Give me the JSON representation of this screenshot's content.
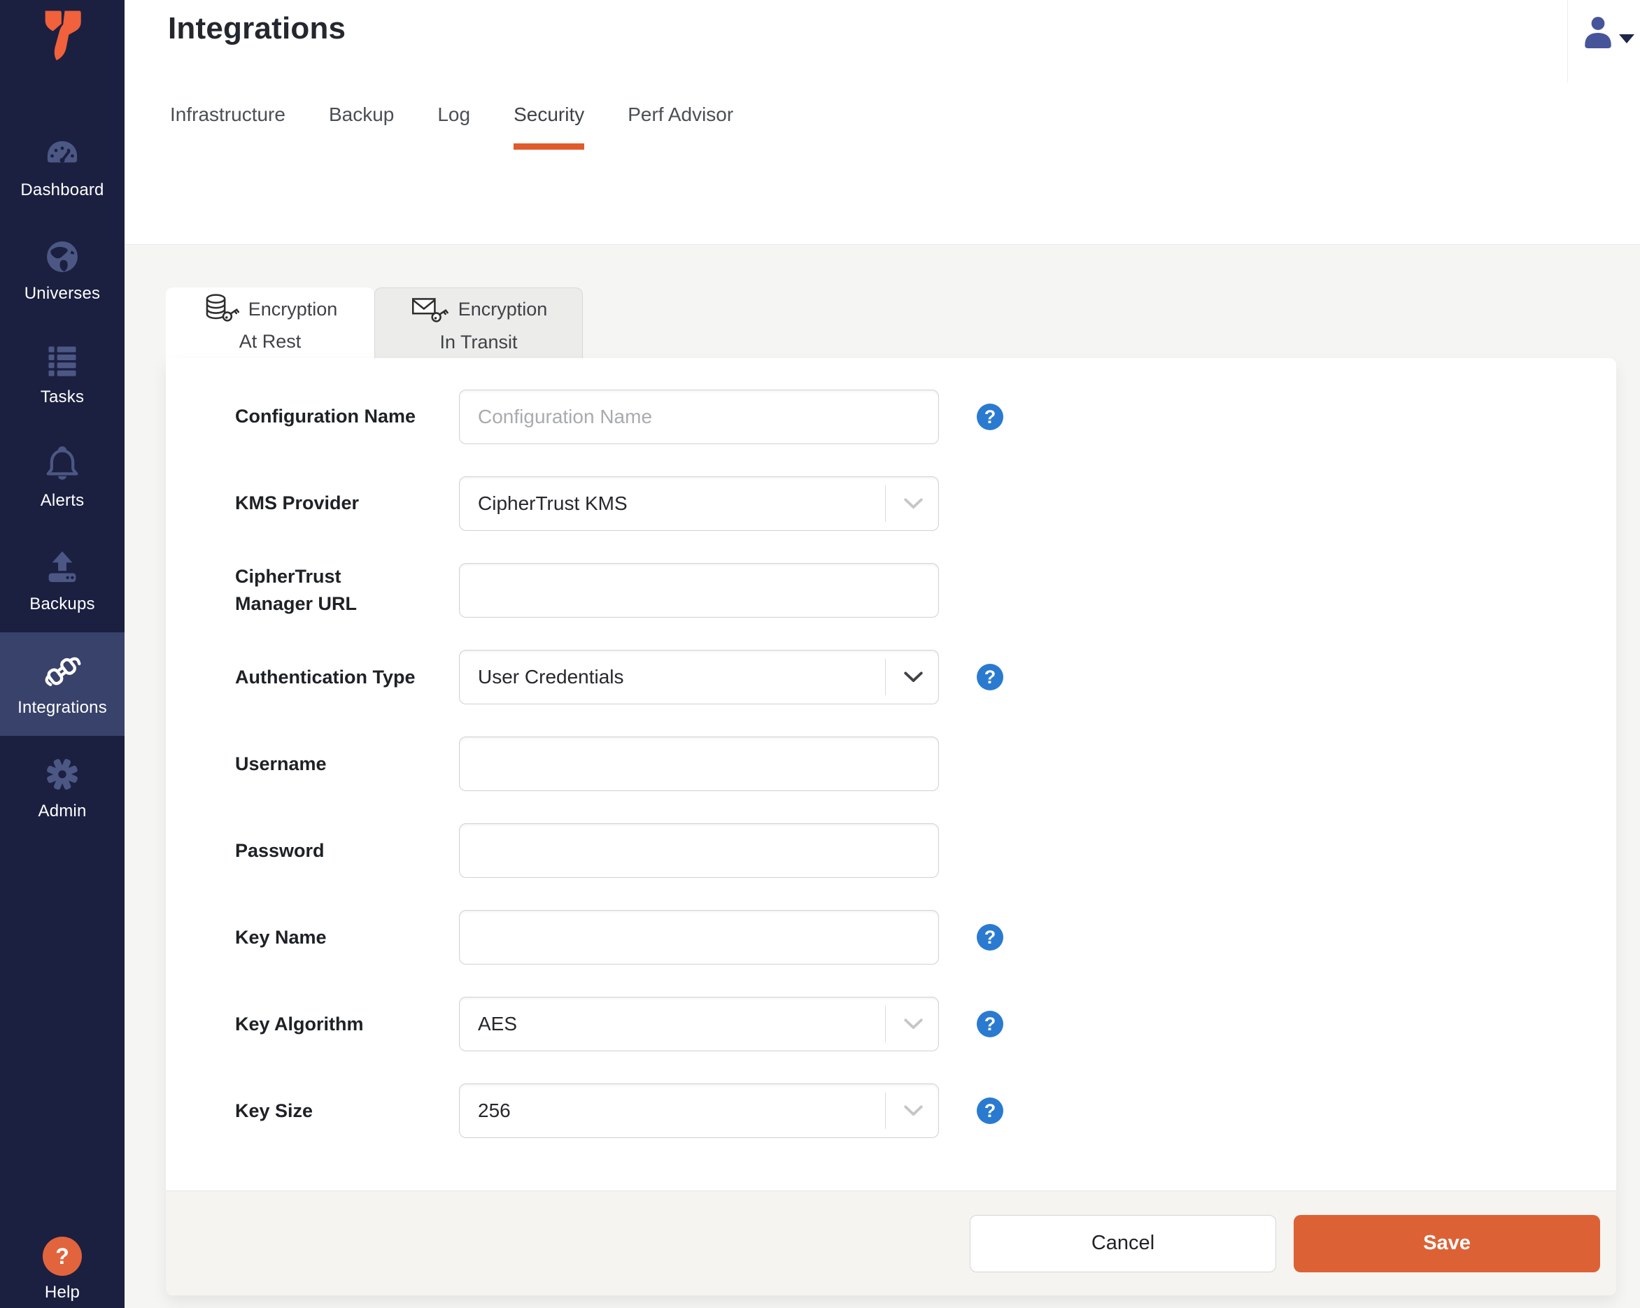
{
  "app": {
    "logo_icon": "yugabyte-y-logo"
  },
  "header": {
    "title": "Integrations",
    "tabs": [
      {
        "label": "Infrastructure",
        "active": false
      },
      {
        "label": "Backup",
        "active": false
      },
      {
        "label": "Log",
        "active": false
      },
      {
        "label": "Security",
        "active": true
      },
      {
        "label": "Perf Advisor",
        "active": false
      }
    ],
    "user_icon": "user-avatar-icon"
  },
  "sidebar": {
    "items": [
      {
        "label": "Dashboard",
        "icon": "dashboard-gauge-icon",
        "active": false
      },
      {
        "label": "Universes",
        "icon": "universes-globe-icon",
        "active": false
      },
      {
        "label": "Tasks",
        "icon": "tasks-list-icon",
        "active": false
      },
      {
        "label": "Alerts",
        "icon": "alerts-bell-icon",
        "active": false
      },
      {
        "label": "Backups",
        "icon": "backups-upload-icon",
        "active": false
      },
      {
        "label": "Integrations",
        "icon": "integrations-plug-icon",
        "active": true
      },
      {
        "label": "Admin",
        "icon": "admin-gear-icon",
        "active": false
      }
    ],
    "help": {
      "label": "Help",
      "icon": "help-question-icon"
    }
  },
  "encryption_tabs": [
    {
      "line1": "Encryption",
      "line2": "At Rest",
      "icon": "database-key-icon",
      "active": true
    },
    {
      "line1": "Encryption",
      "line2": "In Transit",
      "icon": "envelope-key-icon",
      "active": false
    }
  ],
  "form": {
    "fields": [
      {
        "label": "Configuration Name",
        "control": "input",
        "placeholder": "Configuration Name",
        "value": "",
        "help": true
      },
      {
        "label": "KMS Provider",
        "control": "select",
        "value": "CipherTrust KMS",
        "help": false,
        "chevron": "light"
      },
      {
        "label": "CipherTrust Manager URL",
        "control": "input",
        "placeholder": "",
        "value": "",
        "help": false
      },
      {
        "label": "Authentication Type",
        "control": "select",
        "value": "User Credentials",
        "help": true,
        "chevron": "dark"
      },
      {
        "label": "Username",
        "control": "input",
        "placeholder": "",
        "value": "",
        "help": false
      },
      {
        "label": "Password",
        "control": "input",
        "placeholder": "",
        "value": "",
        "help": false
      },
      {
        "label": "Key Name",
        "control": "input",
        "placeholder": "",
        "value": "",
        "help": true
      },
      {
        "label": "Key Algorithm",
        "control": "select",
        "value": "AES",
        "help": true,
        "chevron": "light"
      },
      {
        "label": "Key Size",
        "control": "select",
        "value": "256",
        "help": true,
        "chevron": "light"
      }
    ],
    "actions": {
      "cancel": "Cancel",
      "save": "Save"
    }
  },
  "ui": {
    "help_glyph": "?"
  },
  "colors": {
    "brand_orange": "#f0613c",
    "tab_underline_orange": "#e05b2b",
    "save_orange": "#dc6236",
    "help_orange": "#e2643c",
    "sidebar_bg": "#1b2040",
    "sidebar_active_bg": "#39426b",
    "sidebar_icon": "#4c5784",
    "help_blue": "#2a7ad0",
    "page_bg": "#f5f5f3"
  }
}
